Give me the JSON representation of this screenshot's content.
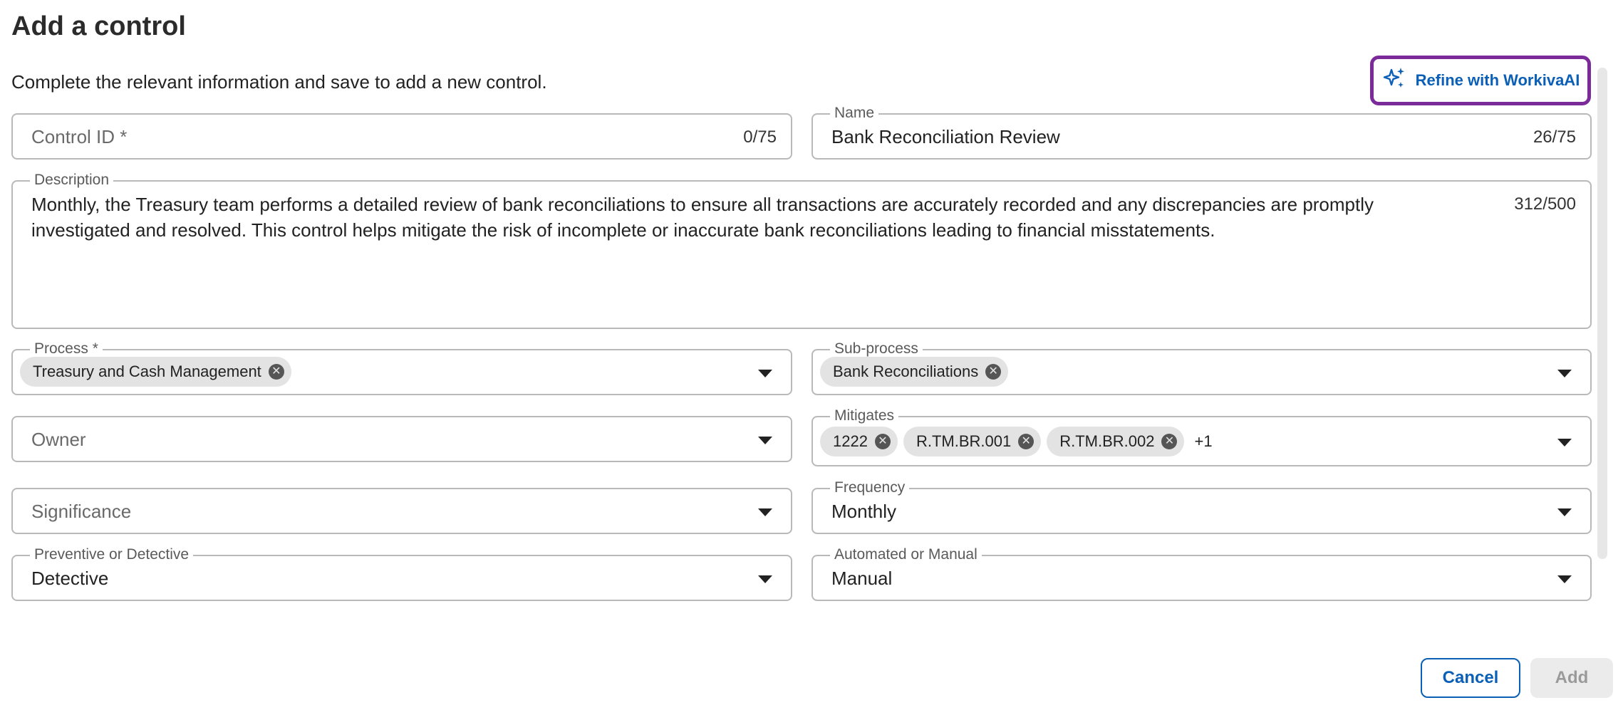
{
  "dialog": {
    "title": "Add a control",
    "subtitle": "Complete the relevant information and save to add a new control."
  },
  "refine": {
    "label": "Refine with WorkivaAI",
    "icon": "sparkles-icon",
    "color": "#0b5fb6",
    "border_color": "#7b2a99"
  },
  "fields": {
    "control_id": {
      "placeholder": "Control ID *",
      "counter": "0/75"
    },
    "name": {
      "label": "Name",
      "value": "Bank Reconciliation Review",
      "counter": "26/75"
    },
    "description": {
      "label": "Description",
      "value": "Monthly, the Treasury team performs a detailed review of bank reconciliations to ensure all transactions are accurately recorded and any discrepancies are promptly investigated and resolved. This control helps mitigate the risk of incomplete or inaccurate bank reconciliations leading to financial misstatements.",
      "counter": "312/500"
    },
    "process": {
      "label": "Process *",
      "chips": [
        "Treasury and Cash Management"
      ]
    },
    "sub_process": {
      "label": "Sub-process",
      "chips": [
        "Bank Reconciliations"
      ]
    },
    "owner": {
      "placeholder": "Owner"
    },
    "mitigates": {
      "label": "Mitigates",
      "chips": [
        "1222",
        "R.TM.BR.001",
        "R.TM.BR.002"
      ],
      "more": "+1"
    },
    "significance": {
      "placeholder": "Significance"
    },
    "frequency": {
      "label": "Frequency",
      "value": "Monthly"
    },
    "preventive_or_detective": {
      "label": "Preventive or Detective",
      "value": "Detective"
    },
    "automated_or_manual": {
      "label": "Automated or Manual",
      "value": "Manual"
    }
  },
  "actions": {
    "cancel": "Cancel",
    "add": "Add"
  }
}
